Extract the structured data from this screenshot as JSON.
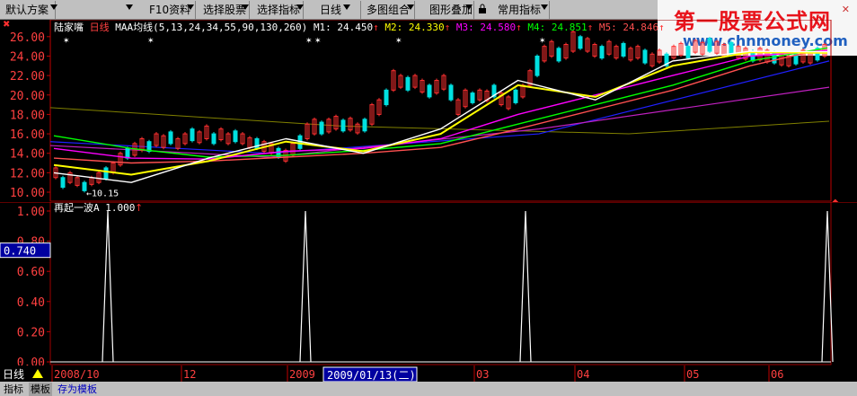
{
  "toolbar": {
    "items": [
      {
        "label": "默认方案"
      },
      {
        "label": "F10资料"
      },
      {
        "label": "选择股票"
      },
      {
        "label": "选择指标"
      },
      {
        "label": "日线"
      },
      {
        "label": "多图组合"
      },
      {
        "label": "图形叠加"
      },
      {
        "label": "常用指标"
      }
    ]
  },
  "watermark": {
    "title": "第一股票公式网",
    "url": "www.chnmoney.com"
  },
  "main_chart": {
    "stock_name": "陆家嘴",
    "period": "日线",
    "indicator_name": "MAA均线(5,13,24,34,55,90,130,260)",
    "legend": [
      {
        "label": "M1: 24.450",
        "color": "#ffffff"
      },
      {
        "label": "M2: 24.330",
        "color": "#ffff00"
      },
      {
        "label": "M3: 24.580",
        "color": "#ff00ff"
      },
      {
        "label": "M4: 24.851",
        "color": "#00ff00"
      },
      {
        "label": "M5: 24.846",
        "color": "#ff5050"
      }
    ],
    "y_ticks": [
      "26.00",
      "24.00",
      "22.00",
      "20.00",
      "18.00",
      "16.00",
      "14.00",
      "12.00",
      "10.00"
    ],
    "min_label": "10.15"
  },
  "sub_chart": {
    "indicator_label": "再起一波A 1.000",
    "y_ticks": [
      "1.00",
      "0.80",
      "0.60",
      "0.40",
      "0.20",
      "0.00"
    ],
    "cursor_value": "0.740"
  },
  "date_axis": {
    "period_label": "日线",
    "labels": [
      "2008/10",
      "12",
      "2009",
      "03",
      "04",
      "05",
      "06"
    ],
    "cursor_date": "2009/01/13(二)"
  },
  "bottom_tabs": [
    "指标",
    "模板",
    "存为模板"
  ],
  "chart_data": [
    {
      "type": "line",
      "title": "MAA均线(5,13,24,34,55,90,130,260)",
      "ylim": [
        10,
        27
      ],
      "x": [
        "2008/10",
        "12",
        "2009",
        "03",
        "04",
        "05",
        "06"
      ],
      "series": [
        {
          "name": "M1",
          "color": "#ffffff",
          "values": [
            12.0,
            11.0,
            13.5,
            15.5,
            14.0,
            16.5,
            21.5,
            19.5,
            23.5,
            24.5,
            24.45
          ]
        },
        {
          "name": "M2",
          "color": "#ffff00",
          "values": [
            12.8,
            11.8,
            13.2,
            15.2,
            14.2,
            16.0,
            21.0,
            19.8,
            23.0,
            24.4,
            24.33
          ]
        },
        {
          "name": "M3",
          "color": "#ff00ff",
          "values": [
            14.5,
            13.5,
            13.4,
            14.2,
            14.5,
            15.5,
            18.0,
            20.0,
            22.0,
            24.0,
            24.58
          ]
        },
        {
          "name": "M4",
          "color": "#00ff00",
          "values": [
            15.8,
            14.5,
            13.6,
            13.8,
            14.3,
            15.0,
            17.0,
            19.0,
            21.0,
            23.5,
            24.851
          ]
        },
        {
          "name": "M5",
          "color": "#ff5050",
          "values": [
            13.5,
            13.0,
            13.2,
            13.6,
            14.0,
            14.6,
            16.5,
            18.5,
            20.5,
            23.0,
            24.846
          ]
        }
      ]
    },
    {
      "type": "line",
      "title": "再起一波A",
      "ylim": [
        0,
        1
      ],
      "signals": [
        {
          "x": "2008/10",
          "value": 1.0
        },
        {
          "x": "2009",
          "value": 1.0
        },
        {
          "x": "03",
          "value": 1.0
        },
        {
          "x": "06",
          "value": 1.0
        }
      ]
    }
  ]
}
